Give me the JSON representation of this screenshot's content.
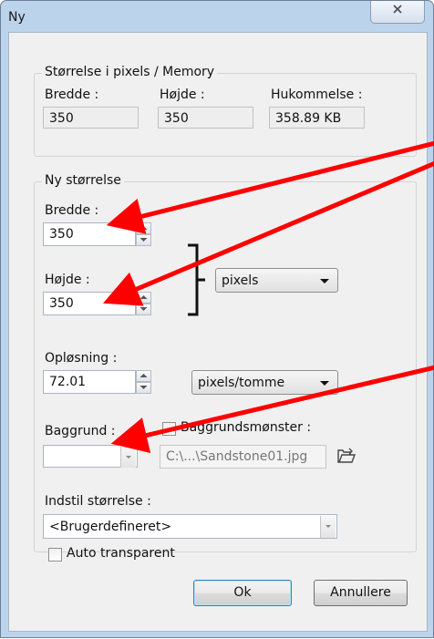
{
  "window": {
    "title": "Ny",
    "close_glyph": "☒"
  },
  "size_group": {
    "legend": "Størrelse i pixels / Memory",
    "width_label": "Bredde :",
    "width_value": "350",
    "height_label": "Højde :",
    "height_value": "350",
    "memory_label": "Hukommelse :",
    "memory_value": "358.89 KB"
  },
  "new_size": {
    "legend": "Ny størrelse",
    "width_label": "Bredde :",
    "width_value": "350",
    "height_label": "Højde :",
    "height_value": "350",
    "unit_selected": "pixels",
    "resolution_label": "Opløsning :",
    "resolution_value": "72.01",
    "resolution_unit_selected": "pixels/tomme",
    "background_label": "Baggrund :",
    "pattern_label": "Baggrundsmønster :",
    "pattern_checked": false,
    "pattern_path": "C:\\...\\Sandstone01.jpg",
    "preset_label": "Indstil størrelse :",
    "preset_selected": "<Brugerdefineret>"
  },
  "auto_transparent": {
    "label": "Auto transparent",
    "checked": false
  },
  "buttons": {
    "ok": "Ok",
    "cancel": "Annullere"
  },
  "colors": {
    "annotation_arrow": "#ff0000",
    "title_bar": "#bcd3ec"
  }
}
